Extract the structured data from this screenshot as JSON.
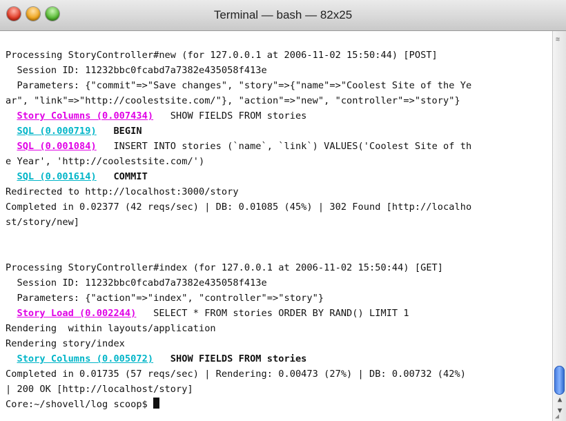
{
  "window": {
    "title": "Terminal — bash — 82x25"
  },
  "terminal": {
    "lines": [
      [
        {
          "t": "Processing StoryController#new (for 127.0.0.1 at 2006-11-02 15:50:44) [POST]"
        }
      ],
      [
        {
          "t": "  Session ID: 11232bbc0fcabd7a7382e435058f413e"
        }
      ],
      [
        {
          "t": "  Parameters: {\"commit\"=>\"Save changes\", \"story\"=>{\"name\"=>\"Coolest Site of the Ye"
        }
      ],
      [
        {
          "t": "ar\", \"link\"=>\"http://coolestsite.com/\"}, \"action\"=>\"new\", \"controller\"=>\"story\"}"
        }
      ],
      [
        {
          "t": "  "
        },
        {
          "t": "Story Columns (0.007434)",
          "c": "mag"
        },
        {
          "t": "   SHOW FIELDS FROM stories"
        }
      ],
      [
        {
          "t": "  "
        },
        {
          "t": "SQL (0.000719)",
          "c": "cyan"
        },
        {
          "t": "   "
        },
        {
          "t": "BEGIN",
          "c": "bold"
        }
      ],
      [
        {
          "t": "  "
        },
        {
          "t": "SQL (0.001084)",
          "c": "mag"
        },
        {
          "t": "   INSERT INTO stories (`name`, `link`) VALUES('Coolest Site of th"
        }
      ],
      [
        {
          "t": "e Year', 'http://coolestsite.com/')"
        }
      ],
      [
        {
          "t": "  "
        },
        {
          "t": "SQL (0.001614)",
          "c": "cyan"
        },
        {
          "t": "   "
        },
        {
          "t": "COMMIT",
          "c": "bold"
        }
      ],
      [
        {
          "t": "Redirected to http://localhost:3000/story"
        }
      ],
      [
        {
          "t": "Completed in 0.02377 (42 reqs/sec) | DB: 0.01085 (45%) | 302 Found [http://localho"
        }
      ],
      [
        {
          "t": "st/story/new]"
        }
      ],
      [
        {
          "t": ""
        }
      ],
      [
        {
          "t": ""
        }
      ],
      [
        {
          "t": "Processing StoryController#index (for 127.0.0.1 at 2006-11-02 15:50:44) [GET]"
        }
      ],
      [
        {
          "t": "  Session ID: 11232bbc0fcabd7a7382e435058f413e"
        }
      ],
      [
        {
          "t": "  Parameters: {\"action\"=>\"index\", \"controller\"=>\"story\"}"
        }
      ],
      [
        {
          "t": "  "
        },
        {
          "t": "Story Load (0.002244)",
          "c": "mag"
        },
        {
          "t": "   SELECT * FROM stories ORDER BY RAND() LIMIT 1"
        }
      ],
      [
        {
          "t": "Rendering  within layouts/application"
        }
      ],
      [
        {
          "t": "Rendering story/index"
        }
      ],
      [
        {
          "t": "  "
        },
        {
          "t": "Story Columns (0.005072)",
          "c": "cyan"
        },
        {
          "t": "   "
        },
        {
          "t": "SHOW FIELDS FROM stories",
          "c": "bold"
        }
      ],
      [
        {
          "t": "Completed in 0.01735 (57 reqs/sec) | Rendering: 0.00473 (27%) | DB: 0.00732 (42%)"
        }
      ],
      [
        {
          "t": "| 200 OK [http://localhost/story]"
        }
      ],
      [
        {
          "t": "Core:~/shovell/log scoop$ "
        }
      ]
    ]
  }
}
